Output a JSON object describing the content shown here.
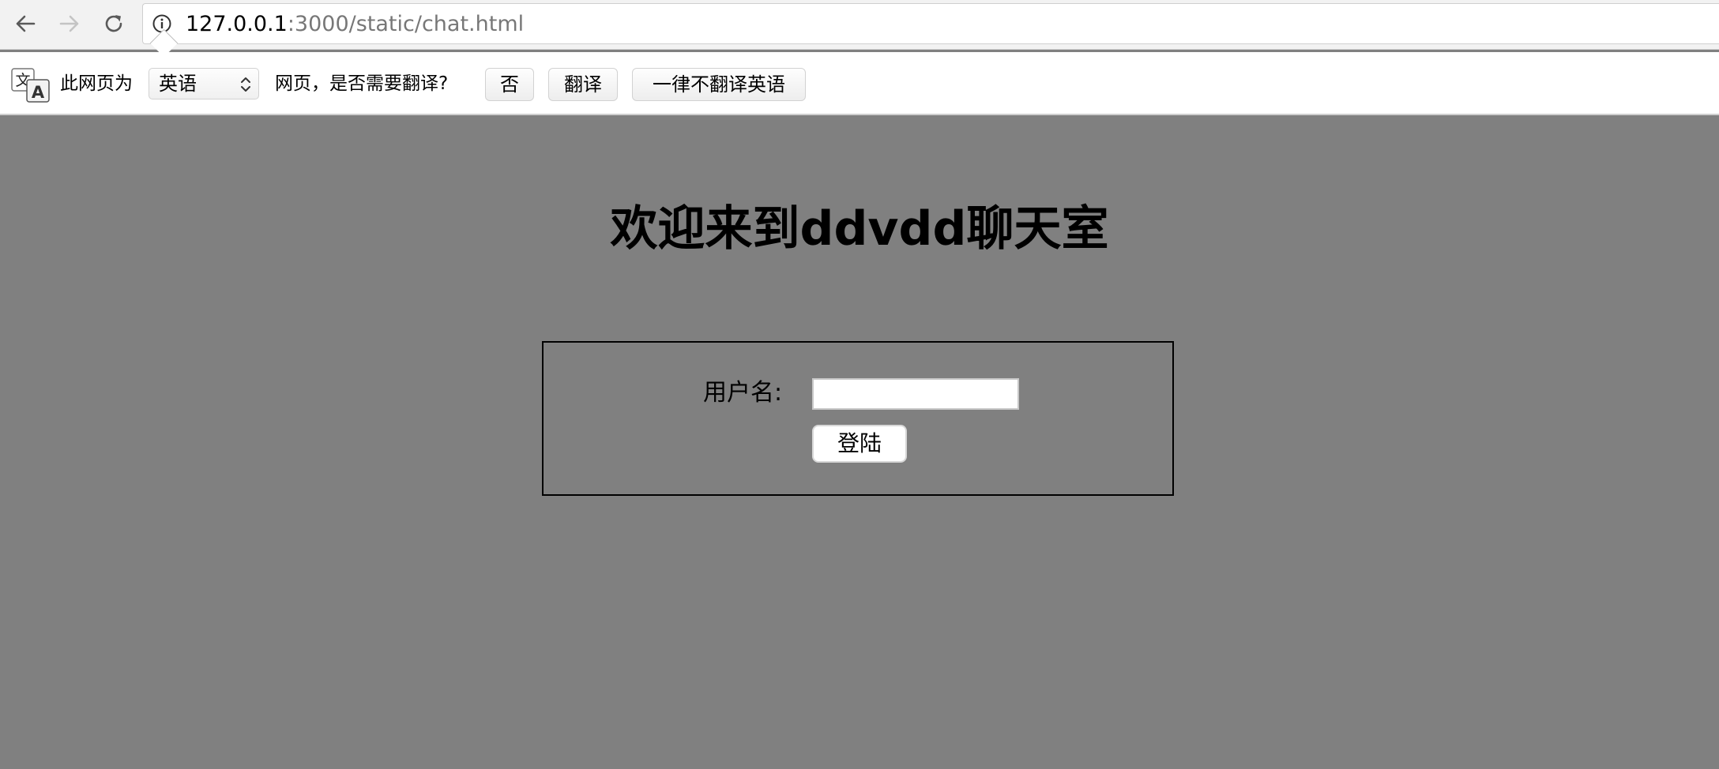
{
  "browser": {
    "url_host": "127.0.0.1",
    "url_rest": ":3000/static/chat.html",
    "icons": {
      "back": "arrow-left-icon",
      "forward": "arrow-right-icon",
      "reload": "reload-icon",
      "site_info": "info-icon"
    }
  },
  "translate_bar": {
    "prefix_text": "此网页为",
    "selected_language": "英语",
    "question_text": "网页，是否需要翻译?",
    "no_button": "否",
    "translate_button": "翻译",
    "never_button": "一律不翻译英语",
    "icon_glyph_top": "文",
    "icon_glyph_bottom": "A"
  },
  "page": {
    "title": "欢迎来到ddvdd聊天室",
    "username_label": "用户名:",
    "username_value": "",
    "login_button": "登陆",
    "background_color": "#808080"
  }
}
